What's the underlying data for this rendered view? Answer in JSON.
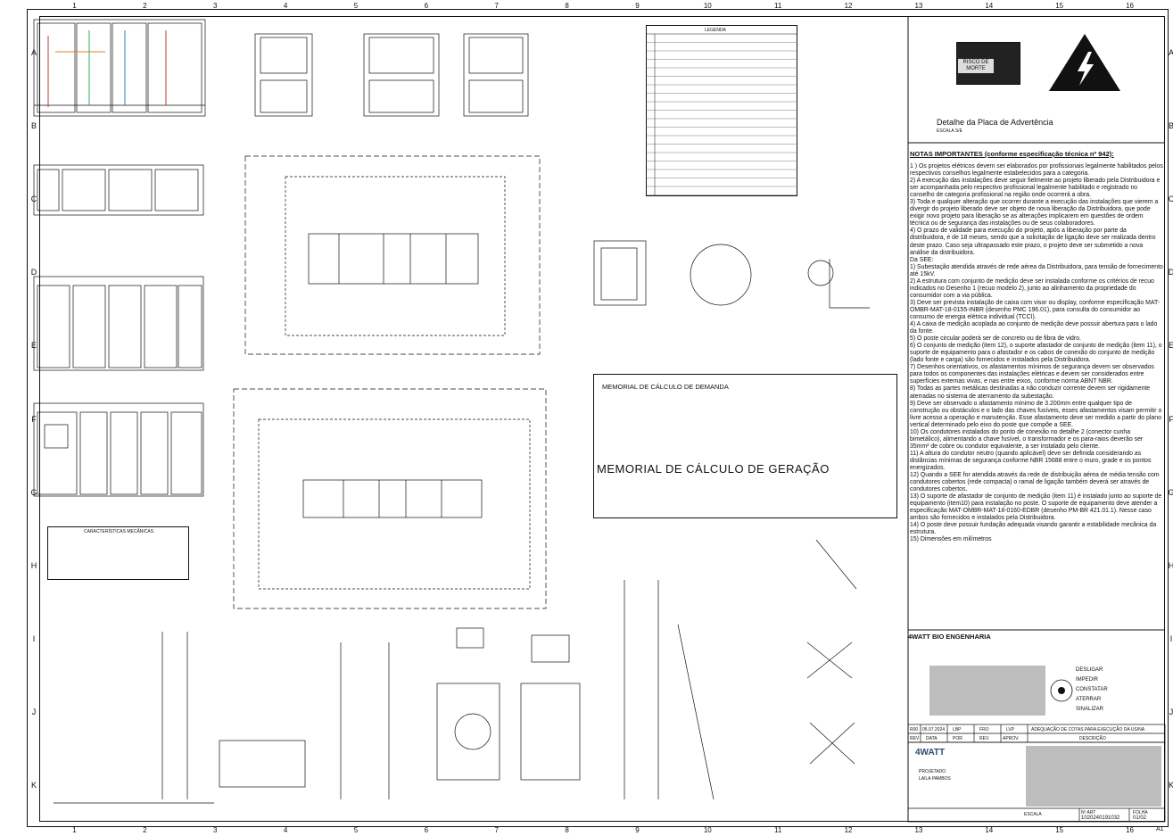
{
  "sheet": {
    "columns": [
      "1",
      "2",
      "3",
      "4",
      "5",
      "6",
      "7",
      "8",
      "9",
      "10",
      "11",
      "12",
      "13",
      "14",
      "15",
      "16"
    ],
    "rows": [
      "A",
      "B",
      "C",
      "D",
      "E",
      "F",
      "G",
      "H",
      "I",
      "J",
      "K"
    ]
  },
  "warning_plate": {
    "text": "RISCO DE MORTE",
    "title": "Detalhe da Placa de Advertência",
    "scale": "ESCALA S/E"
  },
  "notes": {
    "title": "NOTAS IMPORTANTES (conforme especificação técnica nº 942):",
    "items": [
      "1 ) Os projetos elétricos devem ser elaborados por profissionais legalmente habilitados pelos respectivos conselhos legalmente estabelecidos para a categoria.",
      "2) A execução das instalações deve seguir fielmente ao projeto liberado pela Distribuidora e ser acompanhada pelo respectivo profissional legalmente habilitado e registrado no conselho de categoria profissional na região onde ocorrerá a obra.",
      "3) Toda e qualquer alteração que ocorrer durante a execução das instalações que vierem a divergir do projeto liberado deve ser objeto de nova liberação da Distribuidora, que pode exigir novo projeto para liberação se as alterações implicarem em questões de ordem técnica ou de segurança das instalações ou de seus colaboradores.",
      "4) O prazo de validade para execução do projeto, após a liberação por parte da distribuidora, é de 18 meses, sendo que a solicitação de ligação deve ser realizada dentro deste prazo. Caso seja ultrapassado este prazo, o projeto deve ser submetido a nova análise da distribuidora.",
      "Da SEE:",
      "1)      Subestação atendida através de rede aérea da Distribuidora, para tensão de fornecimento até 15kV.",
      "2)      A estrutura com conjunto de medição deve ser instalada conforme os critérios de recuo indicados no Desenho 1 (recuo modelo 2), junto ao alinhamento da propriedade do consumidor com a via pública.",
      "3)      Deve ser prevista instalação de caixa com visor ou display, conforme especificação MAT-OMBR-MAT-18-0155-INBR (desenho PMC 196.01), para consulta do consumidor ao consumo de energia elétrica individual (TCCI).",
      "4)      A caixa de medição acoplada ao conjunto de medição deve possuir abertura para o lado da fonte.",
      "5)      O poste circular poderá ser de concreto ou de fibra de vidro.",
      "6)      O conjunto de medição (item 12), o suporte afastador de conjunto de medição (item 11), o suporte de equipamento para o afastador e os cabos de conexão do conjunto de medição (lado fonte e carga) são fornecidos e instalados pela Distribuidora.",
      "7)      Desenhos orientativos, os afastamentos mínimos de segurança devem ser observados para todos os componentes das instalações elétricas e devem ser considerados entre superfícies externas vivas, e nas entre eixos, conforme norma ABNT NBR.",
      "8)      Todas as partes metálicas destinadas a não conduzir corrente devem ser rigidamente aterradas no sistema de aterramento da subestação.",
      "9)      Deve ser observado o afastamento mínimo de 3.200mm entre qualquer tipo de construção ou obstáculos e o lado das chaves fusíveis, esses afastamentos visam permitir o livre acesso a operação e manutenção. Esse afastamento deve ser medido a partir do plano vertical determinado pelo eixo do poste que compõe a SEE.",
      "10)    Os condutores instalados do ponto de conexão no detalhe 2 (conector cunha bimetálico), alimentando a chave fusível, o transformador e os para-raios deverão ser 35mm² de cobre ou condutor equivalente, a ser instalado pelo cliente.",
      "11)    A altura do condutor neutro (quando aplicável) deve ser definida considerando as distâncias mínimas de segurança conforme NBR 15688 entre o muro, grade e os pontos energizados.",
      "12)    Quando a SEE for atendida através da rede de distribuição aérea de média tensão com condutores cobertos (rede compacta) o ramal de ligação também deverá ser através de condutores cobertos.",
      "13)    O suporte de afastador de conjunto de medição (item 11) é instalado junto ao suporte de equipamento (item10) para instalação no poste. O suporte de equipamento deve atender a especificação MAT-OMBR-MAT-18-0160-EDBR (desenho PM-BR 421.01.1). Nesse caso ambos são fornecidos e instalados pela Distribuidora.",
      "14)    O poste deve possuir fundação adequada visando garantir a estabilidade mecânica da estrutura.",
      "15)    Dimensões em milímetros"
    ]
  },
  "memorial": {
    "demand_title": "MEMORIAL DE CÁLCULO DE DEMANDA",
    "generation_title": "MEMORIAL DE CÁLCULO DE GERAÇÃO"
  },
  "drawings": {
    "legend_title": "LEGENDA",
    "characteristics_title": "CARACTERÍSTICAS MECÂNICAS"
  },
  "title_block": {
    "company": "4WATT BIO ENGENHARIA",
    "rev_code": "R00",
    "rev_date": "05.07.2024",
    "rev_by1": "LBP",
    "rev_by2": "FRO",
    "rev_by3": "LVP",
    "rev_desc": "ADEQUAÇÃO DE COTAS PARA EXECUÇÃO DA USINA",
    "hdr_rev": "REV",
    "hdr_data": "DATA",
    "hdr_por": "POR",
    "hdr_rev2": "REV.",
    "hdr_aprov": "APROV.",
    "hdr_desc": "DESCRIÇÃO",
    "logo": "4WATT",
    "client_label": "PROJETADO",
    "client_name": "LAILA PAMBOS",
    "scale_label": "ESCALA",
    "doc_label": "Nº ART",
    "doc_number": "1020240191032",
    "sheet_label": "FOLHA",
    "sheet_number": "01/02",
    "format": "A1",
    "lifesaving": [
      "DESLIGAR",
      "IMPEDIR",
      "CONSTATAR",
      "ATERRAR",
      "SINALIZAR"
    ]
  }
}
